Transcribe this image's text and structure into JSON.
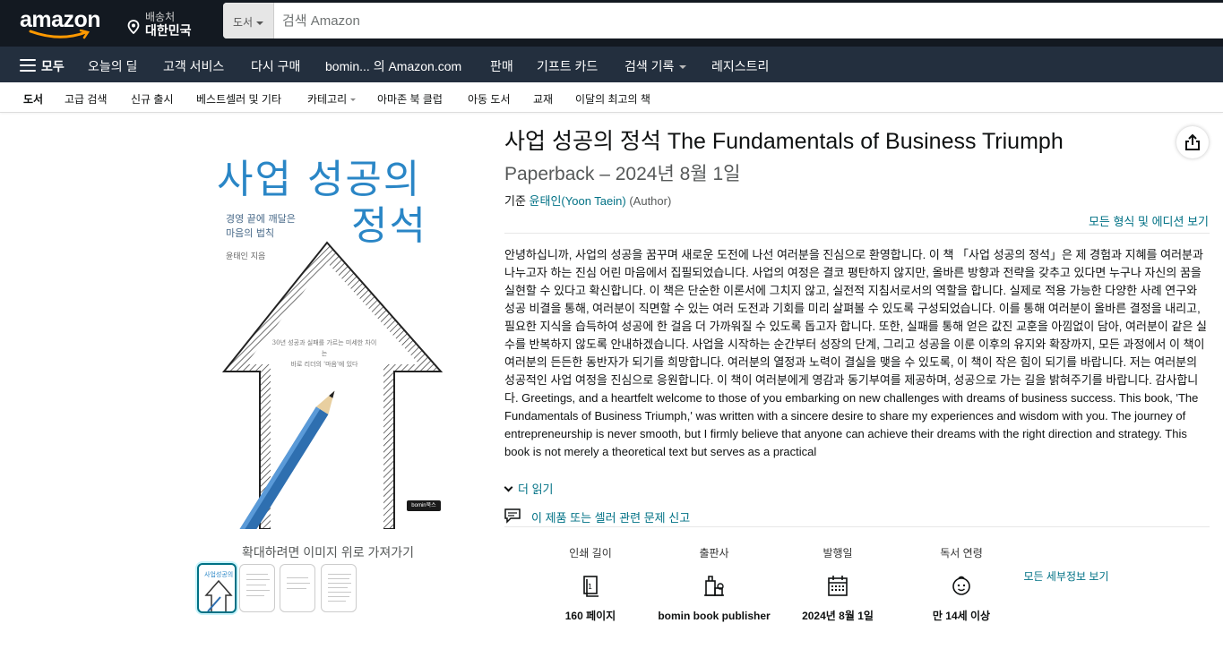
{
  "header": {
    "logo_text": "amazon",
    "deliver_line1": "배송처",
    "deliver_line2": "대한민국",
    "search_category": "도서",
    "search_placeholder": "검색 Amazon"
  },
  "nav_main": {
    "all_label": "모두",
    "items": [
      "오늘의 딜",
      "고객 서비스",
      "다시 구매",
      "bomin... 의 Amazon.com",
      "판매",
      "기프트 카드",
      "검색 기록",
      "레지스트리"
    ]
  },
  "nav_sub": {
    "items": [
      "도서",
      "고급 검색",
      "신규 출시",
      "베스트셀러 및 기타",
      "카테고리",
      "아마존 북 클럽",
      "아동 도서",
      "교재",
      "이달의 최고의 책"
    ]
  },
  "cover": {
    "title_line1": "사업 성공의",
    "title_line2": "정석",
    "subtitle_line1": "경영 끝에 깨달은",
    "subtitle_line2": "마음의 법칙",
    "author": "윤태인 지음",
    "mid_line1": "30년 성공과 실패를 가르는 미세한 차이는",
    "mid_line2": "바로 리더의 '마음'에 있다",
    "publisher_mark": "bomin북스"
  },
  "gallery": {
    "zoom_hint": "확대하려면 이미지 위로 가져가기"
  },
  "product": {
    "title": "사업 성공의 정석 The Fundamentals of Business Triumph",
    "format_date": "Paperback – 2024년 8월 1일",
    "by_prefix": "기준",
    "author": "윤태인(Yoon Taein)",
    "author_role": "(Author)",
    "all_formats": "모든 형식 및 에디션 보기",
    "description": "안녕하십니까, 사업의 성공을 꿈꾸며 새로운 도전에 나선 여러분을 진심으로 환영합니다. 이 책 「사업 성공의 정석」은 제 경험과 지혜를 여러분과 나누고자 하는 진심 어린 마음에서 집필되었습니다. 사업의 여정은 결코 평탄하지 않지만, 올바른 방향과 전략을 갖추고 있다면 누구나 자신의 꿈을 실현할 수 있다고 확신합니다. 이 책은 단순한 이론서에 그치지 않고, 실전적 지침서로서의 역할을 합니다. 실제로 적용 가능한 다양한 사례 연구와 성공 비결을 통해, 여러분이 직면할 수 있는 여러 도전과 기회를 미리 살펴볼 수 있도록 구성되었습니다. 이를 통해 여러분이 올바른 결정을 내리고, 필요한 지식을 습득하여 성공에 한 걸음 더 가까워질 수 있도록 돕고자 합니다. 또한, 실패를 통해 얻은 값진 교훈을 아낌없이 담아, 여러분이 같은 실수를 반복하지 않도록 안내하겠습니다. 사업을 시작하는 순간부터 성장의 단계, 그리고 성공을 이룬 이후의 유지와 확장까지, 모든 과정에서 이 책이 여러분의 든든한 동반자가 되기를 희망합니다. 여러분의 열정과 노력이 결실을 맺을 수 있도록, 이 책이 작은 힘이 되기를 바랍니다. 저는 여러분의 성공적인 사업 여정을 진심으로 응원합니다. 이 책이 여러분에게 영감과 동기부여를 제공하며, 성공으로 가는 길을 밝혀주기를 바랍니다. 감사합니다. Greetings, and a heartfelt welcome to those of you embarking on new challenges with dreams of business success. This book, 'The Fundamentals of Business Triumph,' was written with a sincere desire to share my experiences and wisdom with you. The journey of entrepreneurship is never smooth, but I firmly believe that anyone can achieve their dreams with the right direction and strategy. This book is not merely a theoretical text but serves as a practical",
    "read_more": "더 읽기",
    "report": "이 제품 또는 셀러 관련 문제 신고"
  },
  "details": [
    {
      "label": "인쇄 길이",
      "icon": "book-pages-icon",
      "value": "160 페이지"
    },
    {
      "label": "출판사",
      "icon": "publisher-building-icon",
      "value": "bomin book publisher"
    },
    {
      "label": "발행일",
      "icon": "calendar-icon",
      "value": "2024년 8월 1일"
    },
    {
      "label": "독서 연령",
      "icon": "child-face-icon",
      "value": "만 14세 이상"
    }
  ],
  "see_all_details": "모든 세부정보 보기",
  "colors": {
    "nav_dark": "#131921",
    "nav_secondary": "#232f3e",
    "link": "#007185",
    "accent": "#ff9900",
    "cover_blue": "#2a86c6"
  }
}
